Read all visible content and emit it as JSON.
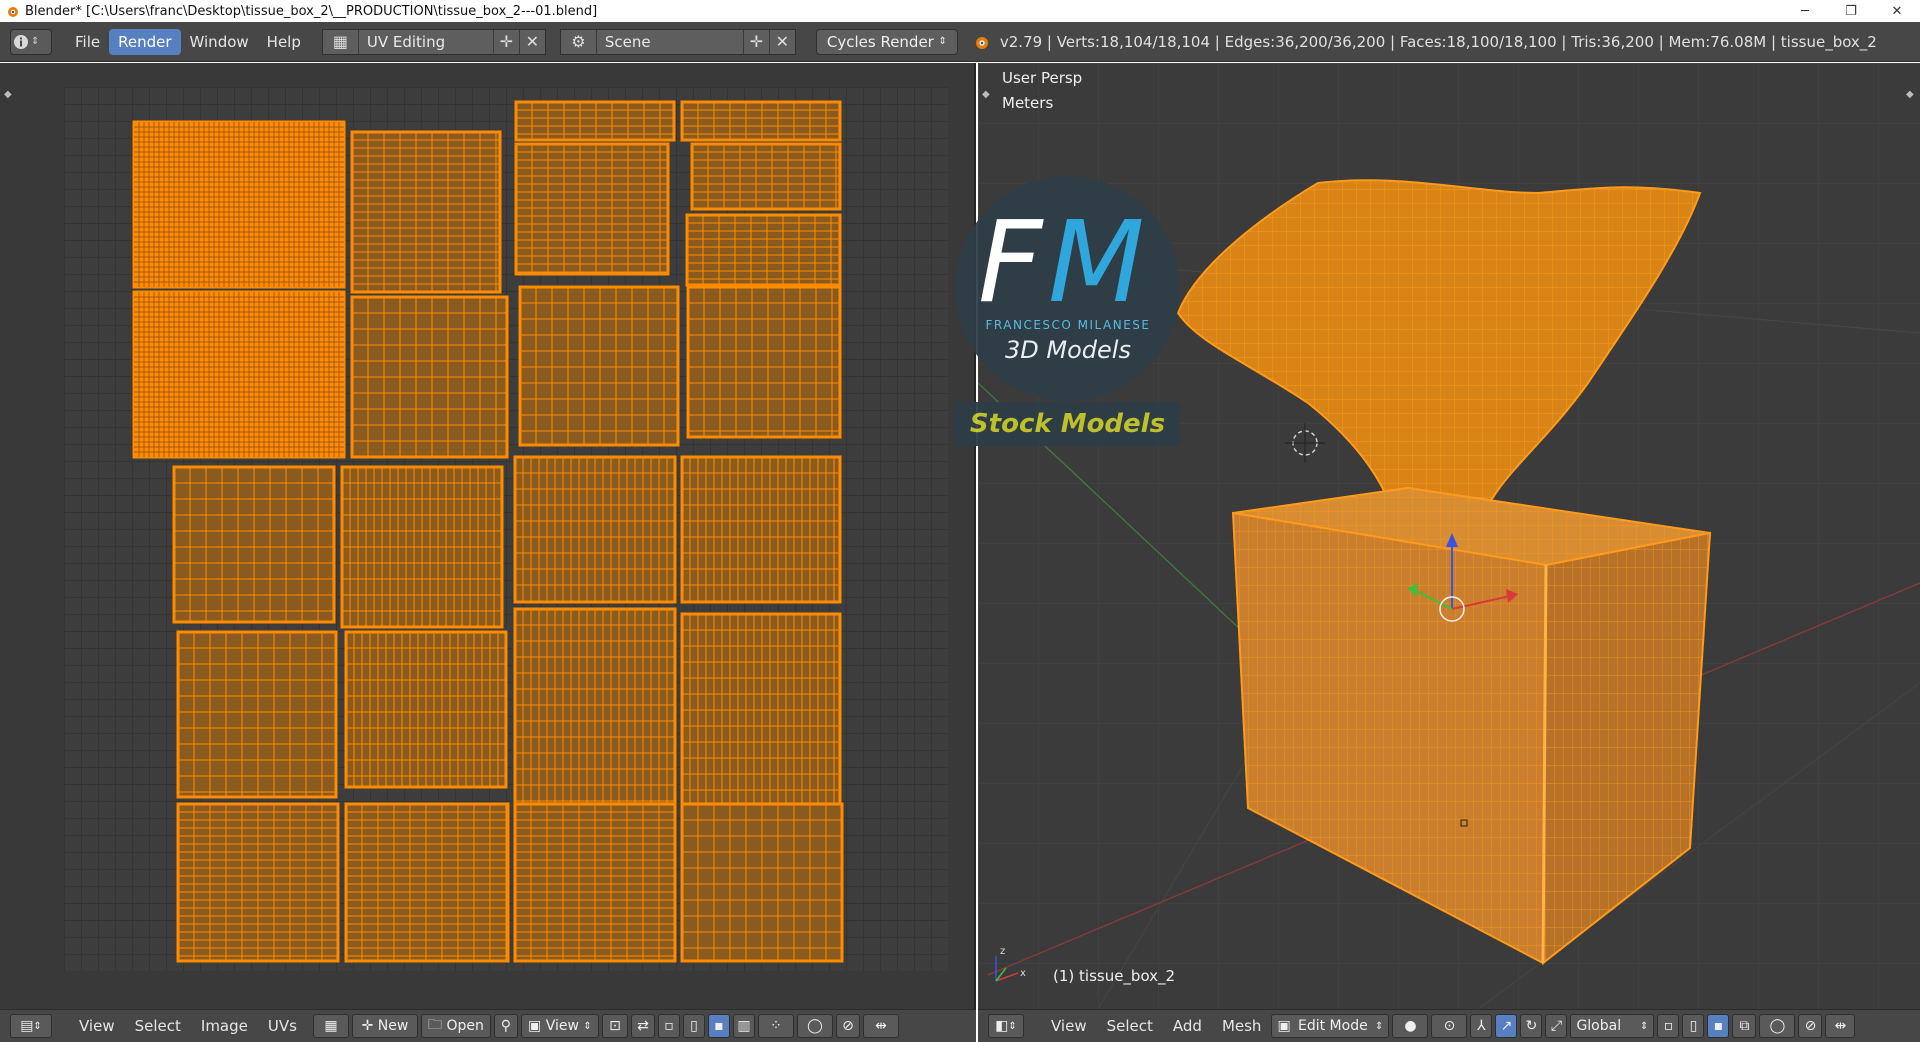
{
  "window": {
    "title": "Blender* [C:\\Users\\franc\\Desktop\\tissue_box_2\\__PRODUCTION\\tissue_box_2---01.blend]",
    "minimize": "─",
    "maximize": "❐",
    "close": "✕"
  },
  "info_header": {
    "menus": [
      "File",
      "Render",
      "Window",
      "Help"
    ],
    "active_menu": "Render",
    "layout_name": "UV Editing",
    "scene_name": "Scene",
    "render_engine": "Cycles Render",
    "stats": "v2.79 | Verts:18,104/18,104 | Edges:36,200/36,200 | Faces:18,100/18,100 | Tris:36,200 | Mem:76.08M | tissue_box_2"
  },
  "viewport": {
    "view_label": "User Persp",
    "units_label": "Meters",
    "object_label": "(1) tissue_box_2"
  },
  "watermark": {
    "letter_f": "F",
    "letter_m": "M",
    "name": "FRANCESCO MILANESE",
    "subtitle": "3D Models",
    "banner": "Stock Models"
  },
  "uv_header": {
    "view": "View",
    "select": "Select",
    "image": "Image",
    "uvs": "UVs",
    "new": "New",
    "open": "Open",
    "view_dropdown": "View"
  },
  "view3d_header": {
    "view": "View",
    "select": "Select",
    "add": "Add",
    "mesh": "Mesh",
    "mode": "Edit Mode",
    "orientation": "Global"
  },
  "colors": {
    "uv_orange": "#ff8c00",
    "uv_fill": "#8a5a1e",
    "header_bg": "#474747",
    "active_blue": "#5680c2"
  }
}
